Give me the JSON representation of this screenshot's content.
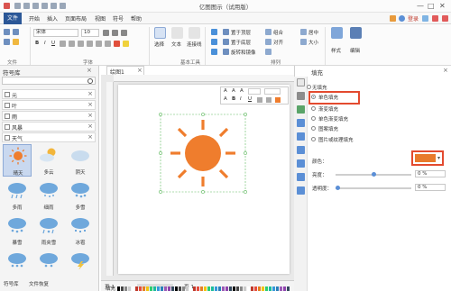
{
  "window": {
    "title": "亿图图示（试用版）",
    "controls": [
      "—",
      "□",
      "✕"
    ]
  },
  "menu": {
    "tabs": [
      "文件",
      "开始",
      "插入",
      "页面布局",
      "视图",
      "符号",
      "帮助"
    ],
    "active_tab": "文件",
    "login": "登录"
  },
  "ribbon": {
    "font_name": "宋体",
    "font_size": "10",
    "group_labels": [
      "文件",
      "字体",
      "基本工具",
      "排列"
    ],
    "tools": [
      "选择",
      "文本",
      "连接线"
    ],
    "arrange": [
      "置于顶层",
      "置于底层",
      "旋转和镜像",
      "组合",
      "对齐",
      "居中",
      "大小"
    ],
    "style_label": "样式",
    "edit_label": "编辑"
  },
  "library": {
    "title": "符号库",
    "categories": [
      "元",
      "叶",
      "雨",
      "风暴",
      "天气"
    ],
    "symbols": [
      "晴天",
      "多云",
      "阴天",
      "多雨",
      "细雨",
      "多雪",
      "暴雪",
      "雨夹雪",
      "冰雹",
      "",
      "",
      ""
    ],
    "bottom_tabs": [
      "符号库",
      "文件恢复"
    ]
  },
  "document": {
    "tab_name": "绘图1",
    "status_page": "页-1",
    "status_page_right": "页-1",
    "fill_label": "填充"
  },
  "float_toolbar": {
    "buttons": [
      "A",
      "A",
      "A",
      "A",
      "B",
      "I",
      "U"
    ]
  },
  "fill_panel": {
    "title": "填充",
    "options": [
      "无填充",
      "单色填充",
      "渐变填充",
      "单色渐变填充",
      "图案填充",
      "图片或纹理填充"
    ],
    "selected_option": "单色填充",
    "color_label": "颜色：",
    "color_value": "#e87a2c",
    "brightness_label": "亮度：",
    "brightness_value": "0 %",
    "transparency_label": "透明度：",
    "transparency_value": "0 %"
  },
  "colors": {
    "sun": "#ef7d2d",
    "accent": "#2b5797",
    "highlight": "#e34a2f"
  }
}
